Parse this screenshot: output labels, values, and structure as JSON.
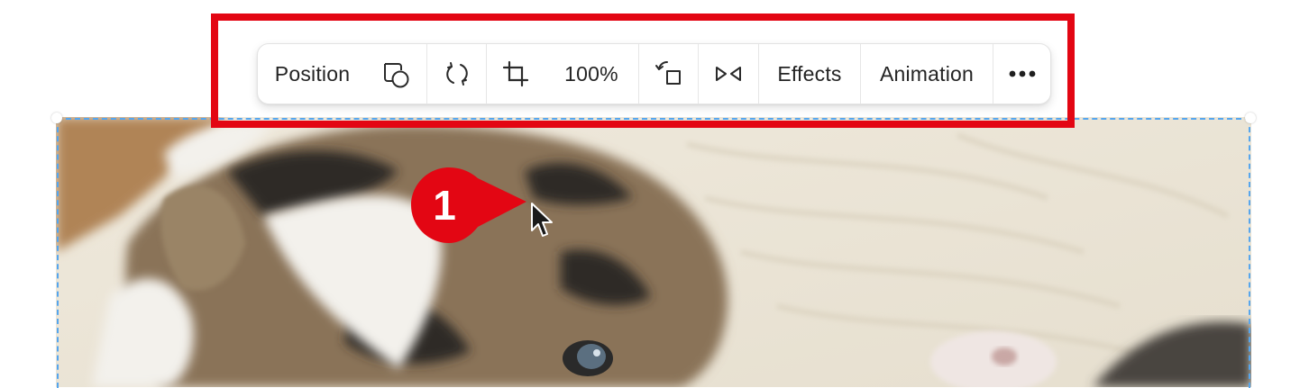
{
  "toolbar": {
    "position_label": "Position",
    "zoom_label": "100%",
    "effects_label": "Effects",
    "animation_label": "Animation",
    "icons": [
      "shapes-icon",
      "rotate-icon",
      "crop-icon",
      "rotate-box-icon",
      "flip-icon",
      "more-icon"
    ]
  },
  "annotation": {
    "step_number": "1",
    "highlight_color": "#e30613",
    "marker_color": "#e30613"
  },
  "image": {
    "subject": "kitten photo",
    "selection_color": "#56a6ee"
  }
}
